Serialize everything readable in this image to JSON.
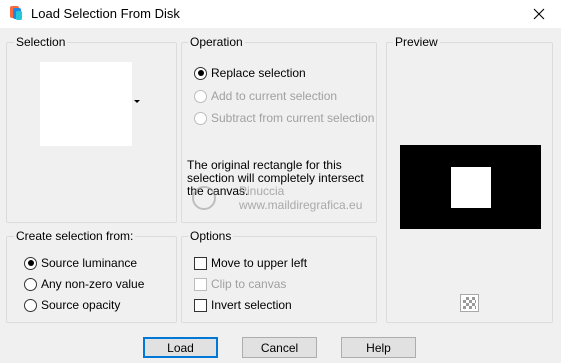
{
  "window": {
    "title": "Load Selection From Disk",
    "icon": "app-logo-icon",
    "close_icon": "close-icon"
  },
  "selection": {
    "label": "Selection"
  },
  "operation": {
    "label": "Operation",
    "options": [
      {
        "label": "Replace selection",
        "checked": true,
        "disabled": false
      },
      {
        "label": "Add to current selection",
        "checked": false,
        "disabled": true
      },
      {
        "label": "Subtract from current selection",
        "checked": false,
        "disabled": true
      }
    ],
    "info": "The original rectangle for this selection will completely intersect the canvas."
  },
  "create_from": {
    "label": "Create selection from:",
    "options": [
      {
        "label": "Source luminance",
        "checked": true
      },
      {
        "label": "Any non-zero value",
        "checked": false
      },
      {
        "label": "Source opacity",
        "checked": false
      }
    ]
  },
  "options": {
    "label": "Options",
    "items": [
      {
        "label": "Move to upper left",
        "checked": false,
        "disabled": false
      },
      {
        "label": "Clip to canvas",
        "checked": false,
        "disabled": true
      },
      {
        "label": "Invert selection",
        "checked": false,
        "disabled": false
      }
    ]
  },
  "preview": {
    "label": "Preview",
    "toggle_icon": "transparency-checker-icon"
  },
  "watermark": {
    "name": "Pinuccia",
    "url": "www.maildiregrafica.eu"
  },
  "buttons": {
    "load": "Load",
    "cancel": "Cancel",
    "help": "Help"
  },
  "colors": {
    "accent": "#0078d7",
    "dialog_bg": "#f0f0f0",
    "preview_bg": "#000000"
  }
}
